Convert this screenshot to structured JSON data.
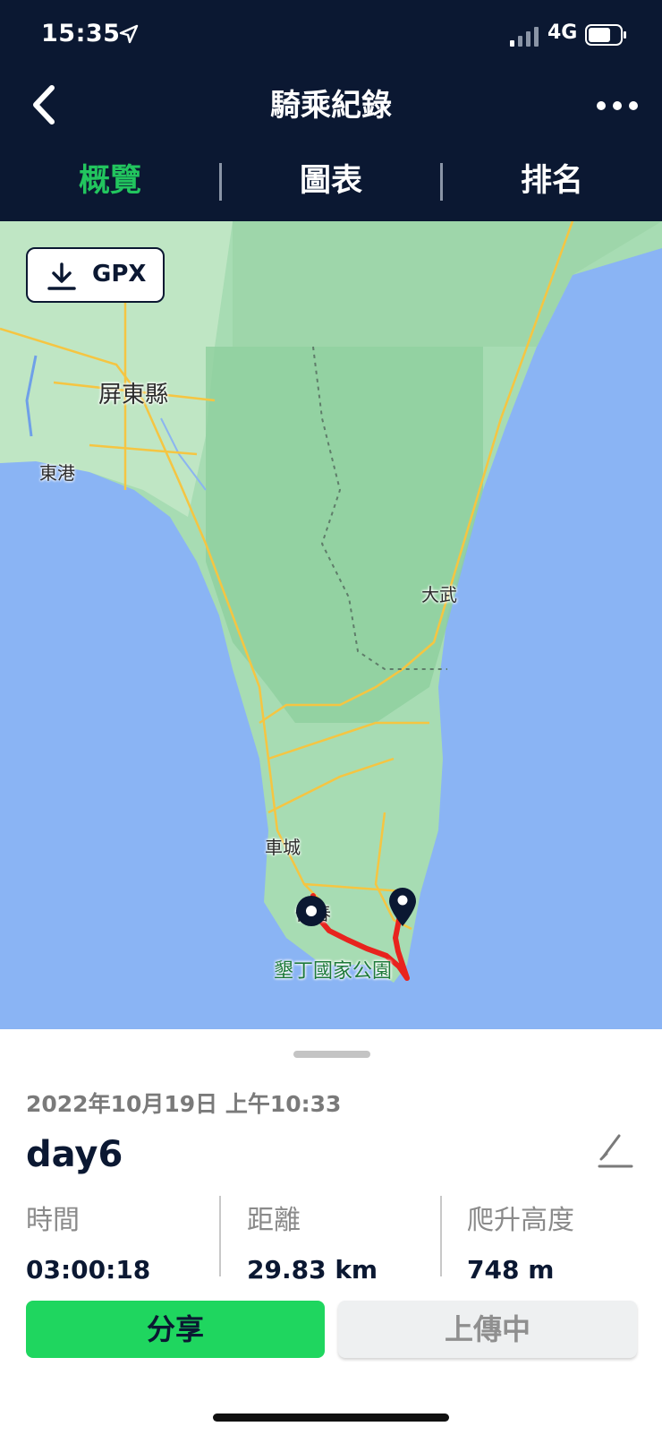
{
  "status_bar": {
    "time": "15:35",
    "network": "4G"
  },
  "header": {
    "title": "騎乘紀錄"
  },
  "tabs": [
    {
      "label": "概覽",
      "active": true
    },
    {
      "label": "圖表",
      "active": false
    },
    {
      "label": "排名",
      "active": false
    }
  ],
  "map": {
    "gpx_label": "GPX",
    "labels": {
      "pingtung": "屏東縣",
      "donggang": "東港",
      "dawu": "大武",
      "checheng": "車城",
      "hengchun": "恆春",
      "kenting": "墾丁國家公園"
    },
    "route_color": "#e8231e"
  },
  "ride": {
    "date": "2022年10月19日 上午10:33",
    "name": "day6",
    "stats": [
      {
        "label": "時間",
        "value": "03:00:18"
      },
      {
        "label": "距離",
        "value": "29.83 km"
      },
      {
        "label": "爬升高度",
        "value": "748 m"
      }
    ]
  },
  "actions": {
    "share": "分享",
    "upload": "上傳中"
  },
  "colors": {
    "header_bg": "#0b1832",
    "accent": "#22c55e",
    "share_bg": "#1fd65f"
  }
}
